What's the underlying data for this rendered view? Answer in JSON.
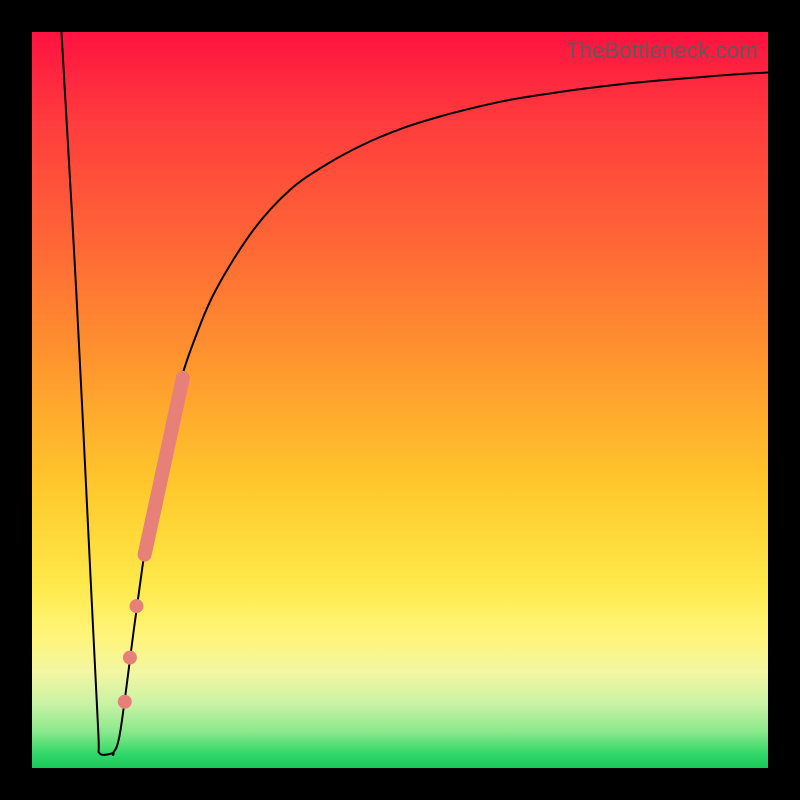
{
  "watermark": "TheBottleneck.com",
  "colors": {
    "curve": "#000000",
    "marker_fill": "#e68079",
    "marker_stroke": "#b85a52"
  },
  "chart_data": {
    "type": "line",
    "title": "",
    "xlabel": "",
    "ylabel": "",
    "x_range": [
      0,
      100
    ],
    "y_range": [
      0,
      100
    ],
    "xlim": [
      0,
      100
    ],
    "ylim": [
      0,
      100
    ],
    "curve": {
      "x": [
        4,
        6,
        8,
        9,
        10,
        11,
        12,
        14,
        16,
        18,
        20,
        22,
        25,
        30,
        35,
        40,
        45,
        50,
        55,
        60,
        65,
        70,
        75,
        80,
        85,
        90,
        95,
        100
      ],
      "y": [
        100,
        65,
        25,
        5,
        2,
        2,
        5,
        20,
        34,
        44,
        52,
        58,
        65,
        73,
        78.5,
        82,
        84.7,
        86.8,
        88.4,
        89.7,
        90.8,
        91.6,
        92.3,
        92.9,
        93.4,
        93.8,
        94.2,
        94.5
      ]
    },
    "flat_bottom": {
      "x_start": 9.2,
      "x_end": 11.0,
      "y": 2
    },
    "markers_segment": {
      "x_start": 15.3,
      "y_start": 29,
      "x_end": 20.5,
      "y_end": 53,
      "radius_px": 7
    },
    "markers_dots": [
      {
        "x": 14.2,
        "y": 22
      },
      {
        "x": 13.3,
        "y": 15
      },
      {
        "x": 12.6,
        "y": 9
      }
    ],
    "annotations": []
  }
}
